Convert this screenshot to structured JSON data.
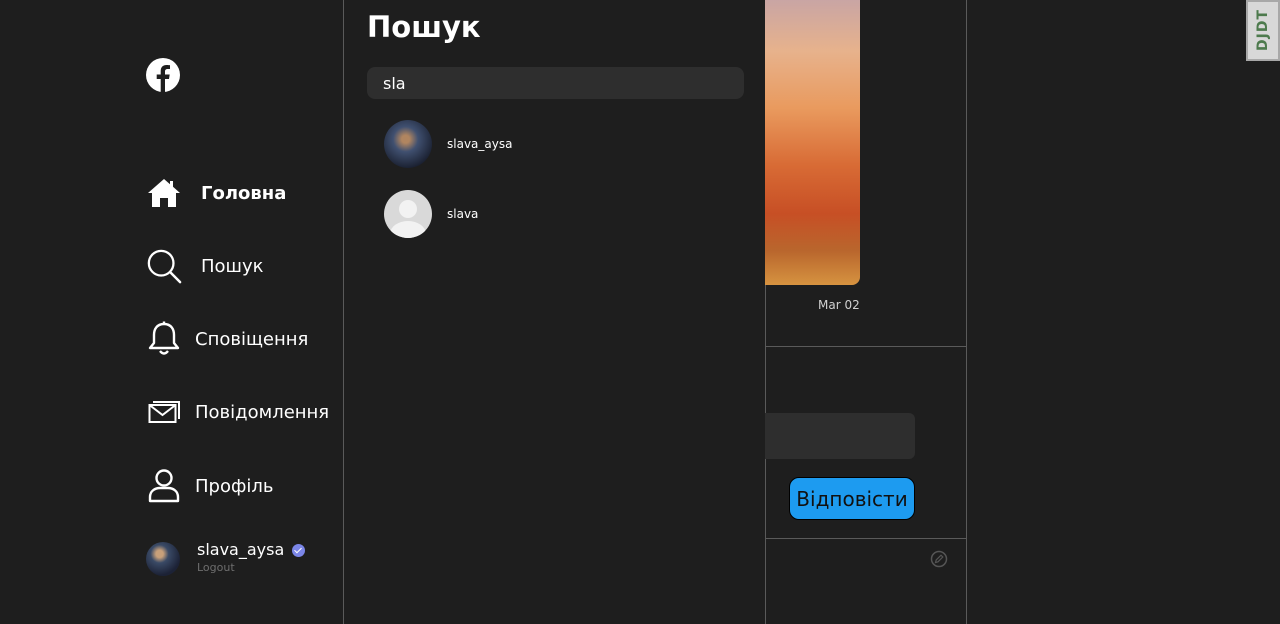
{
  "sidebar": {
    "logo_icon": "facebook-icon",
    "items": [
      {
        "label": "Головна",
        "icon": "home-icon"
      },
      {
        "label": "Пошук",
        "icon": "search-icon"
      },
      {
        "label": "Сповіщення",
        "icon": "bell-icon"
      },
      {
        "label": "Повідомлення",
        "icon": "envelope-icon"
      },
      {
        "label": "Профіль",
        "icon": "user-icon"
      }
    ],
    "user": {
      "name": "slava_aysa",
      "logout": "Logout"
    }
  },
  "search": {
    "title": "Пошук",
    "query": "sla",
    "results": [
      {
        "name": "slava_aysa"
      },
      {
        "name": "slava"
      }
    ]
  },
  "feed": {
    "date": "Mar 02",
    "reply_button": "Відповісти"
  },
  "badge": {
    "text": "DJDT"
  },
  "colors": {
    "background": "#1e1e1e",
    "accent": "#1d9bf0",
    "verified": "#7b86e8"
  }
}
